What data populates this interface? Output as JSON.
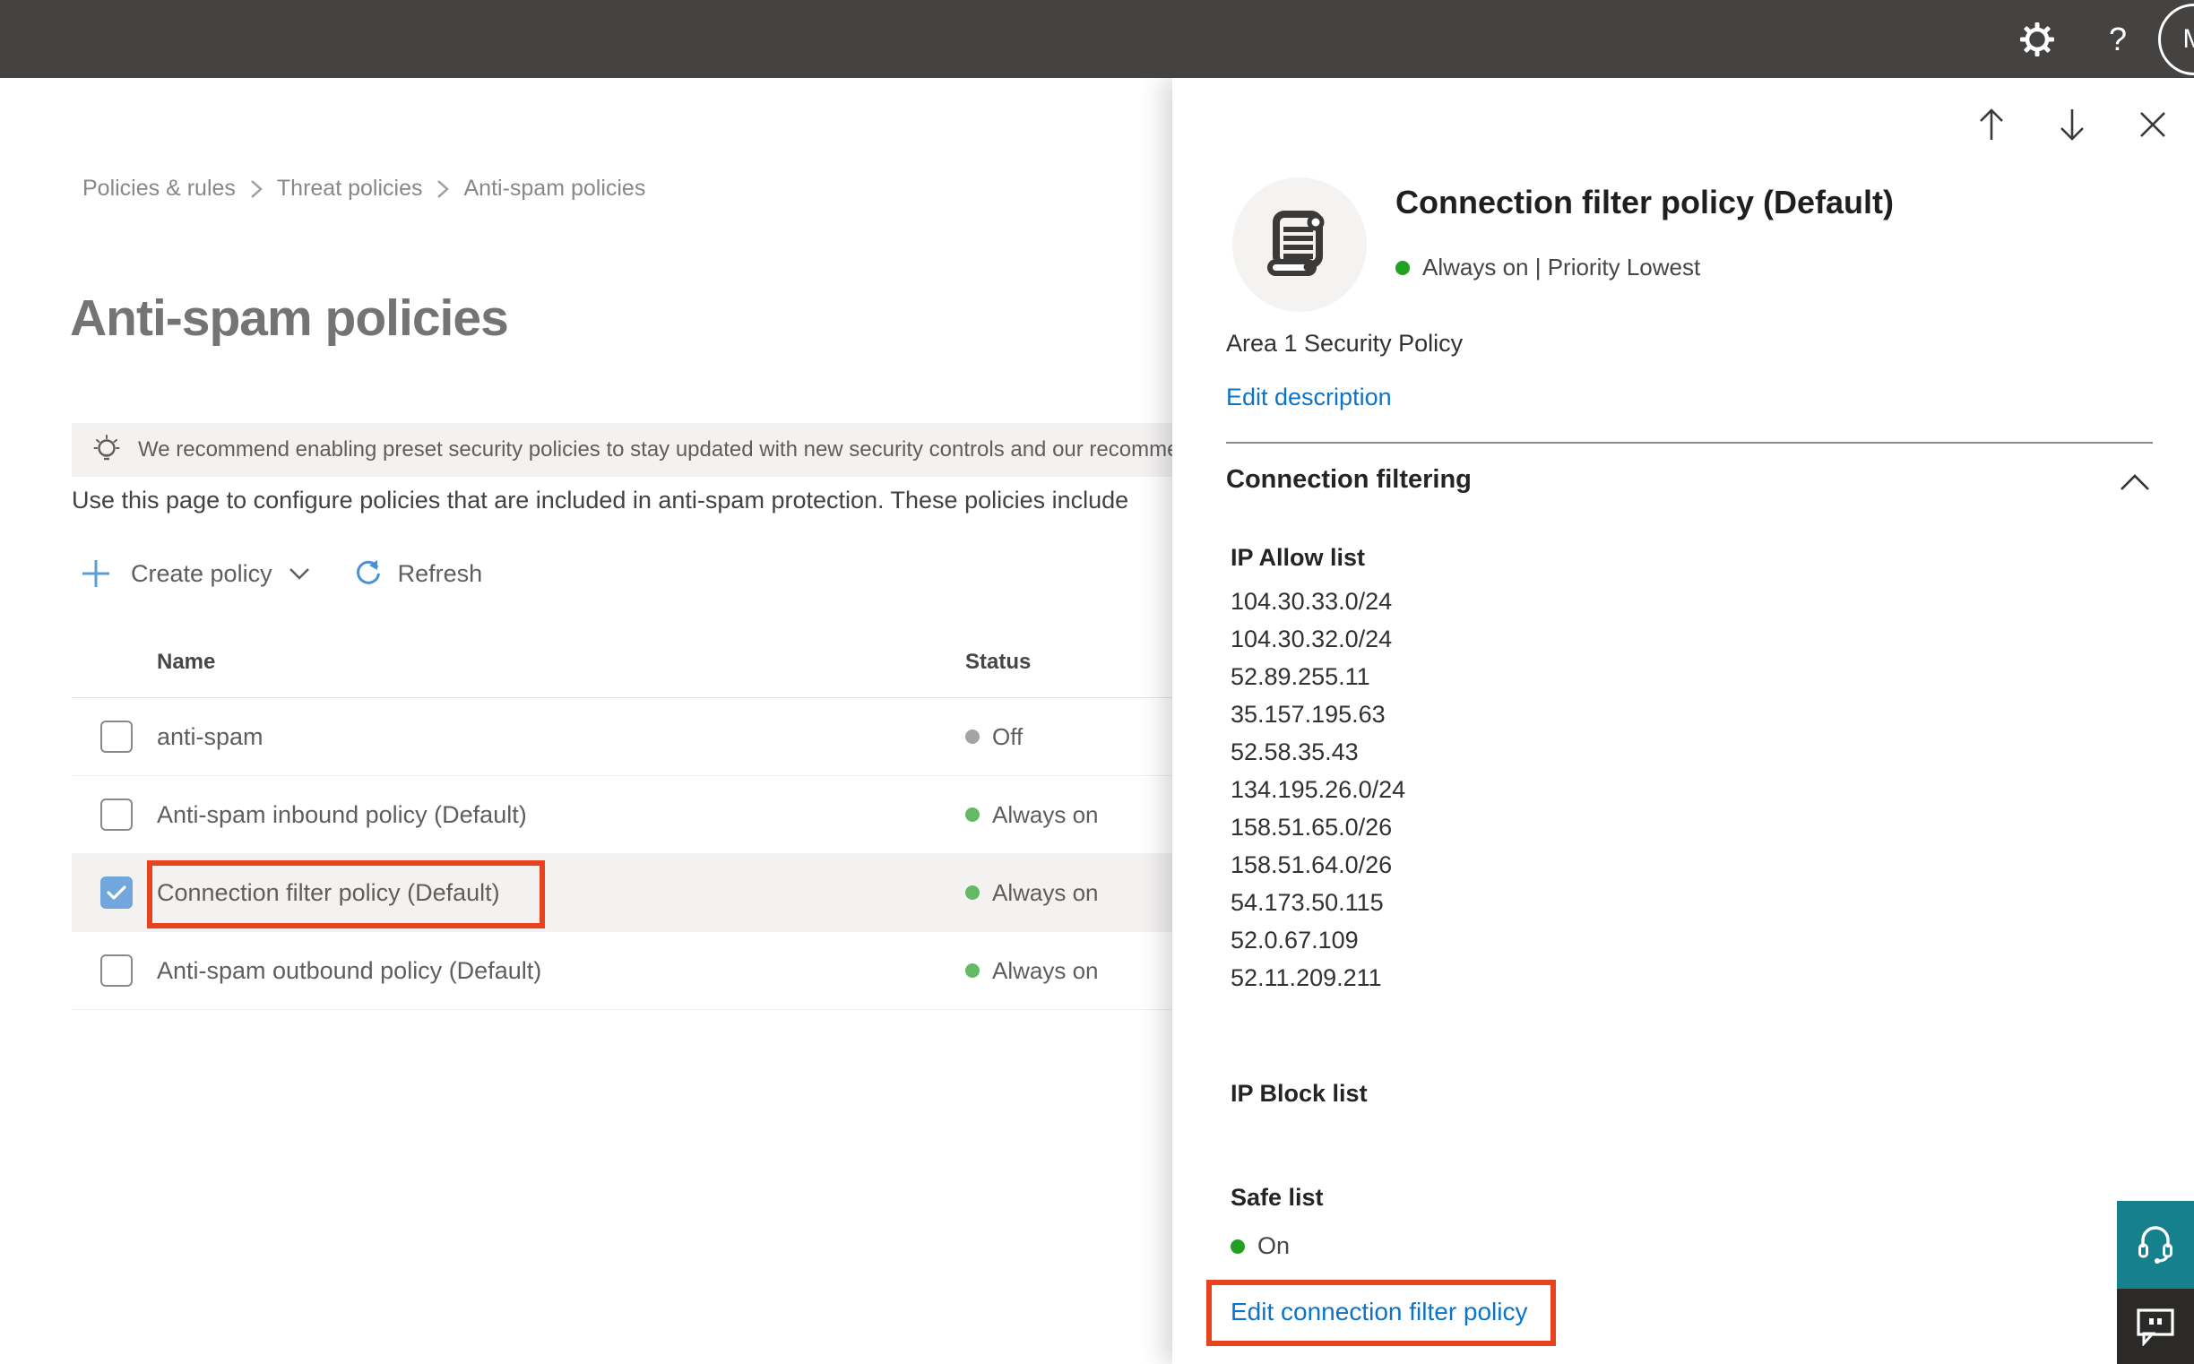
{
  "topbar": {
    "help_glyph": "?",
    "avatar_initial": "M"
  },
  "breadcrumb": {
    "items": [
      "Policies & rules",
      "Threat policies",
      "Anti-spam policies"
    ]
  },
  "page": {
    "title": "Anti-spam policies",
    "banner_text": "We recommend enabling preset security policies to stay updated with new security controls and our recomme",
    "description": "Use this page to configure policies that are included in anti-spam protection. These policies include"
  },
  "toolbar": {
    "create_label": "Create policy",
    "refresh_label": "Refresh"
  },
  "table": {
    "columns": [
      "Name",
      "Status"
    ],
    "rows": [
      {
        "name": "anti-spam",
        "status": "Off",
        "status_color": "#a6a4a2",
        "checked": false,
        "selected": false,
        "annotated": false
      },
      {
        "name": "Anti-spam inbound policy (Default)",
        "status": "Always on",
        "status_color": "#64ba64",
        "checked": false,
        "selected": false,
        "annotated": false
      },
      {
        "name": "Connection filter policy (Default)",
        "status": "Always on",
        "status_color": "#64ba64",
        "checked": true,
        "selected": true,
        "annotated": true
      },
      {
        "name": "Anti-spam outbound policy (Default)",
        "status": "Always on",
        "status_color": "#64ba64",
        "checked": false,
        "selected": false,
        "annotated": false
      }
    ]
  },
  "panel": {
    "title": "Connection filter policy (Default)",
    "status_line": "Always on | Priority Lowest",
    "status_color": "#21a121",
    "description": "Area 1 Security Policy",
    "edit_description_label": "Edit description",
    "section_title": "Connection filtering",
    "ip_allow": {
      "title": "IP Allow list",
      "entries": [
        "104.30.33.0/24",
        "104.30.32.0/24",
        "52.89.255.11",
        "35.157.195.63",
        "52.58.35.43",
        "134.195.26.0/24",
        "158.51.65.0/26",
        "158.51.64.0/26",
        "54.173.50.115",
        "52.0.67.109",
        "52.11.209.211"
      ]
    },
    "ip_block": {
      "title": "IP Block list"
    },
    "safe_list": {
      "title": "Safe list",
      "status": "On",
      "status_color": "#21a121"
    },
    "edit_link_label": "Edit connection filter policy"
  },
  "icons": {
    "settings": "gear-outline",
    "help": "question-mark",
    "lightbulb": "recommendation-bulb",
    "create": "plus",
    "refresh": "circular-arrow",
    "policy": "scroll-document",
    "panel_nav": [
      "arrow-up",
      "arrow-down",
      "close-x"
    ],
    "support": "headset",
    "feedback": "speech-bubble"
  },
  "colors": {
    "topbar_bg": "#454342",
    "accent_blue": "#0b74c9",
    "annotation_red": "#e8421f",
    "selected_row_bg": "#f3f2f1",
    "checkbox_checked": "#71a7dc",
    "support_teal": "#16808d",
    "feedback_dark": "#2b2a28"
  }
}
